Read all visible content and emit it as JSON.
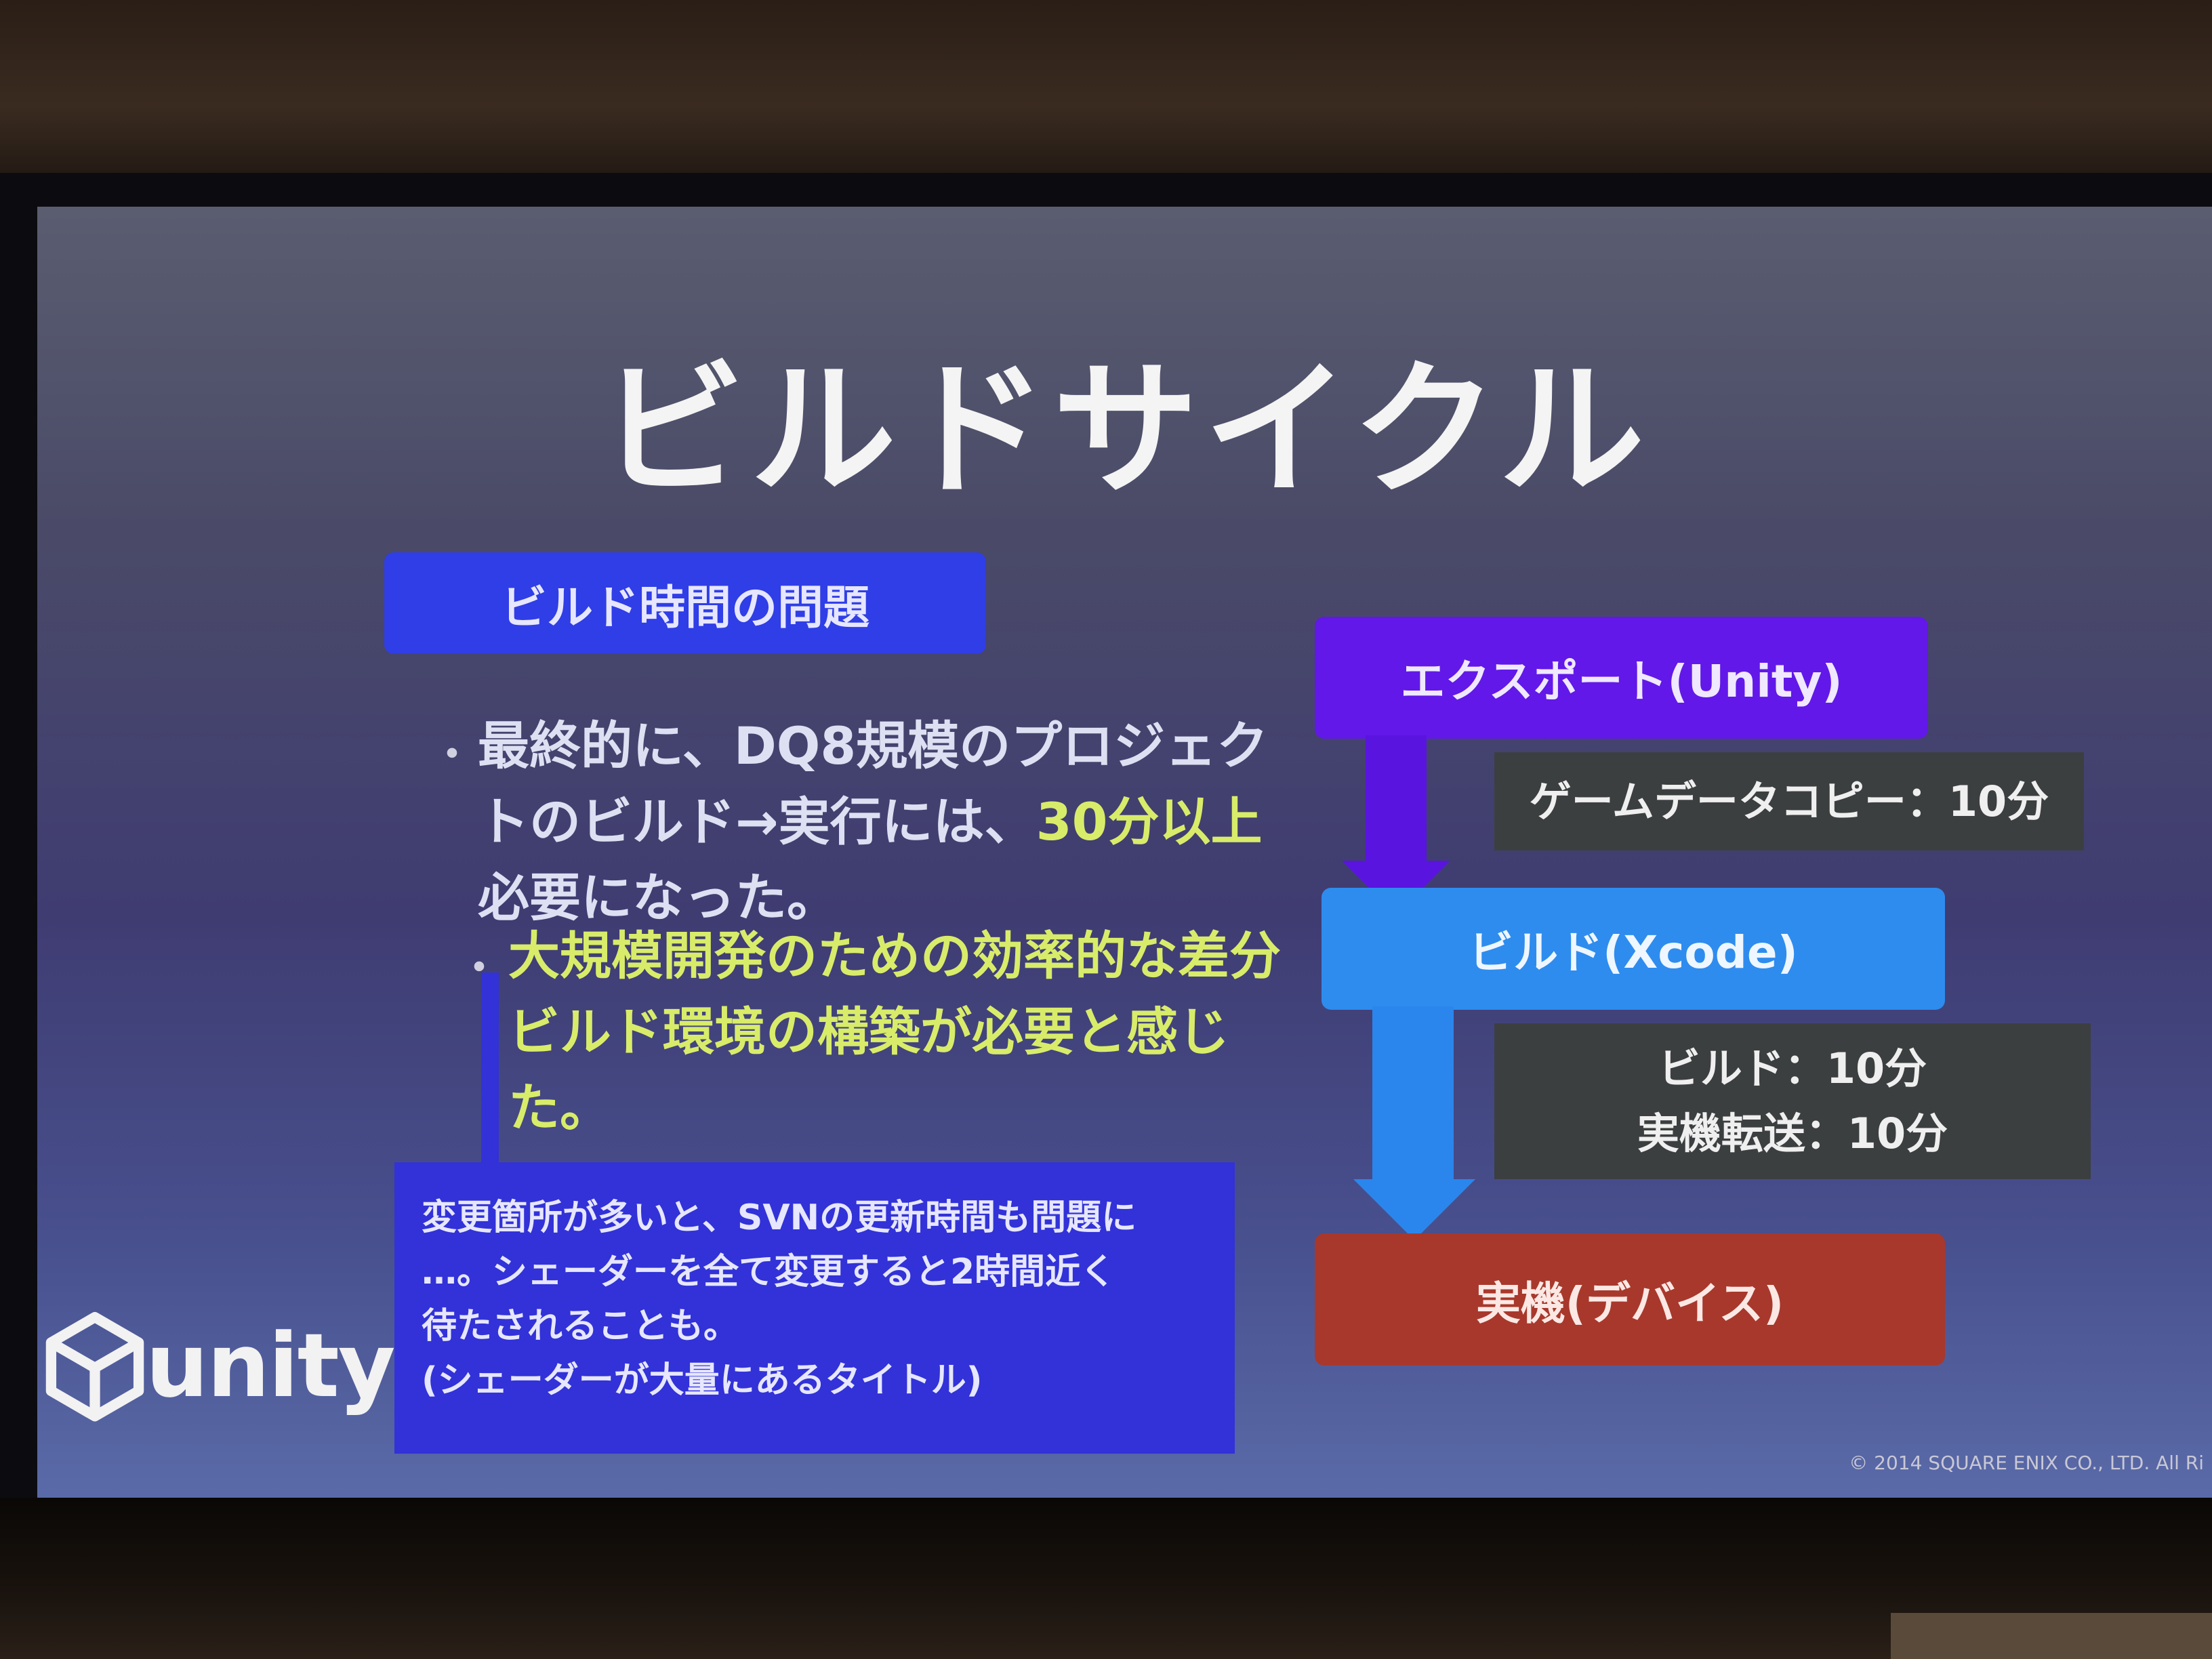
{
  "slide": {
    "title": "ビルドサイクル",
    "problem_header": "ビルド時間の問題",
    "bullet_1_dot": "・",
    "bullet_1_part1": "最終的に、DQ8規模のプロジェクトのビルド→実行には、",
    "bullet_1_highlight": "30分以上",
    "bullet_1_part2": "必要になった。",
    "bullet_2_dot": "・",
    "bullet_2": "大規模開発のための効率的な差分ビルド環境の構築が必要と感じた。",
    "callout": {
      "line_1": "変更箇所が多いと、SVNの更新時間も問題に",
      "line_2": "…。シェーダーを全て変更すると2時間近く",
      "line_3": "待たされることも。",
      "line_4": "(シェーダーが大量にあるタイトル)"
    },
    "flow": {
      "step_1": "エクスポート(Unity)",
      "note_1": "ゲームデータコピー：10分",
      "step_2": "ビルド(Xcode)",
      "note_2_line_1": "ビルド：10分",
      "note_2_line_2": "実機転送：10分",
      "step_3": "実機(デバイス)"
    },
    "logo_text": "unity",
    "copyright": "© 2014 SQUARE ENIX CO., LTD. All Ri"
  },
  "colors": {
    "problem_header": "#2f3ee6",
    "highlight": "#d8ec6a",
    "callout": "#3232d8",
    "step_export": "#6218e8",
    "step_build": "#2e8cee",
    "step_device": "#a8382c",
    "note": "#3c3f40"
  }
}
